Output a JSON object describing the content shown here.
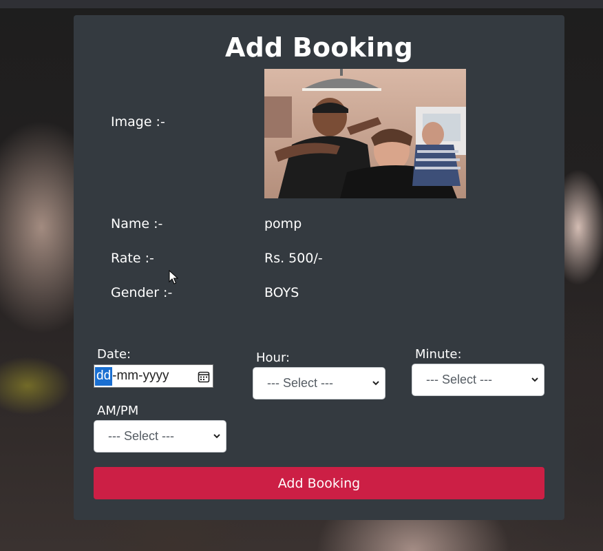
{
  "page": {
    "title": "Add Booking"
  },
  "details": {
    "image_label": "Image :-",
    "name_label": "Name :-",
    "name_value": "pomp",
    "rate_label": "Rate :-",
    "rate_value": "Rs. 500/-",
    "gender_label": "Gender :-",
    "gender_value": "BOYS"
  },
  "form": {
    "date_label": "Date:",
    "date_value_day": "dd",
    "date_value_rest": "-mm-yyyy",
    "hour_label": "Hour:",
    "hour_selected": "--- Select ---",
    "minute_label": "Minute:",
    "minute_selected": "--- Select ---",
    "ampm_label": "AM/PM",
    "ampm_selected": "--- Select ---",
    "submit_label": "Add Booking"
  },
  "colors": {
    "card": "#343a40",
    "submit": "#cc1f45",
    "date_highlight": "#1a6fd1"
  },
  "icons": [
    "calendar-icon",
    "chevron-down-icon",
    "mouse-cursor-icon"
  ]
}
